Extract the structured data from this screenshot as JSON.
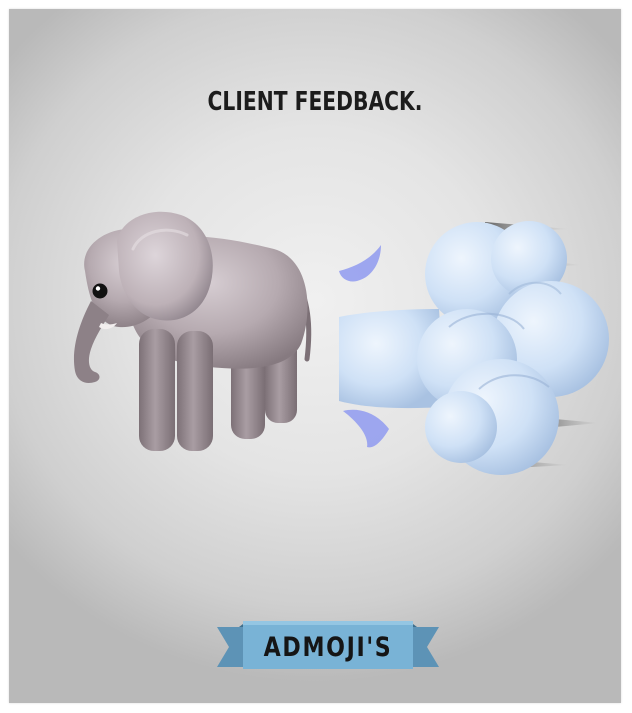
{
  "poster": {
    "headline": "CLIENT FEEDBACK.",
    "banner_label": "ADMOJI'S"
  },
  "illustrations": {
    "left": "elephant-emoji",
    "right": "puff-of-air-emoji"
  },
  "colors": {
    "background": "#e2e2e2",
    "elephant": "#b3a7ad",
    "cloud": "#cfe1f6",
    "drops": "#8f9af0",
    "banner": "#79b3d6",
    "text": "#1c1c1c"
  }
}
